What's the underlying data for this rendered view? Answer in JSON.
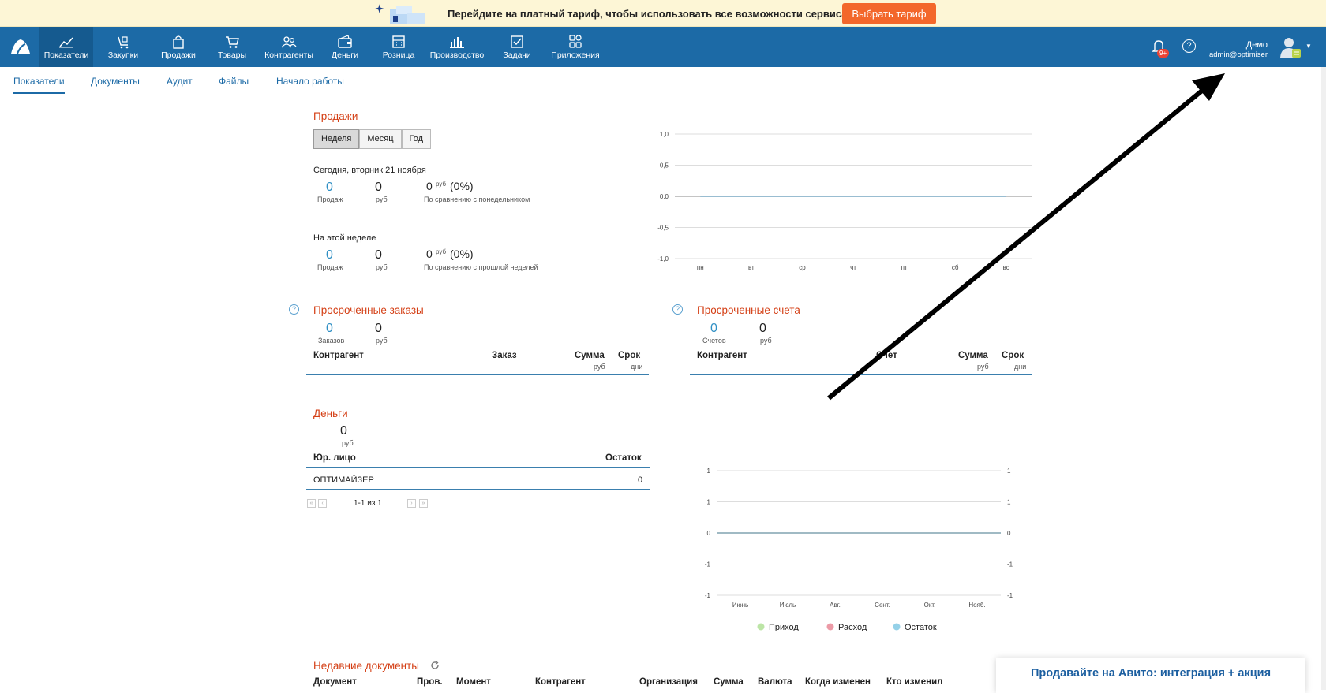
{
  "promo": {
    "text": "Перейдите на платный тариф, чтобы использовать все возможности сервиса",
    "button": "Выбрать тариф"
  },
  "nav": {
    "items": [
      {
        "label": "Показатели",
        "icon": "chart-icon"
      },
      {
        "label": "Закупки",
        "icon": "purchases-icon"
      },
      {
        "label": "Продажи",
        "icon": "bag-icon"
      },
      {
        "label": "Товары",
        "icon": "cart-icon"
      },
      {
        "label": "Контрагенты",
        "icon": "people-icon"
      },
      {
        "label": "Деньги",
        "icon": "wallet-icon"
      },
      {
        "label": "Розница",
        "icon": "register-icon"
      },
      {
        "label": "Производство",
        "icon": "factory-icon"
      },
      {
        "label": "Задачи",
        "icon": "task-icon"
      },
      {
        "label": "Приложения",
        "icon": "apps-icon"
      }
    ],
    "notifications_badge": "9+",
    "help": "?",
    "user_name": "Демо",
    "user_email": "admin@optimiser"
  },
  "subnav": [
    "Показатели",
    "Документы",
    "Аудит",
    "Файлы",
    "Начало работы"
  ],
  "sales": {
    "title": "Продажи",
    "periods": [
      "Неделя",
      "Месяц",
      "Год"
    ],
    "today_label": "Сегодня, вторник 21 ноября",
    "today_count": "0",
    "today_count_label": "Продаж",
    "today_sum": "0",
    "today_sum_label": "руб",
    "today_compare": "0",
    "today_compare_unit": "руб",
    "today_compare_pct": "(0%)",
    "today_compare_label": "По сравнению с понедельником",
    "week_label": "На этой неделе",
    "week_count": "0",
    "week_count_label": "Продаж",
    "week_sum": "0",
    "week_sum_label": "руб",
    "week_compare": "0",
    "week_compare_unit": "руб",
    "week_compare_pct": "(0%)",
    "week_compare_label": "По сравнению с прошлой неделей"
  },
  "overdue_orders": {
    "title": "Просроченные заказы",
    "count": "0",
    "count_label": "Заказов",
    "sum": "0",
    "sum_label": "руб",
    "headers": [
      "Контрагент",
      "Заказ",
      "Сумма",
      "Срок"
    ],
    "sub_sum": "руб",
    "sub_term": "дни"
  },
  "overdue_invoices": {
    "title": "Просроченные счета",
    "count": "0",
    "count_label": "Счетов",
    "sum": "0",
    "sum_label": "руб",
    "headers": [
      "Контрагент",
      "Счет",
      "Сумма",
      "Срок"
    ],
    "sub_sum": "руб",
    "sub_term": "дни"
  },
  "money": {
    "title": "Деньги",
    "total": "0",
    "total_label": "руб",
    "headers": [
      "Юр. лицо",
      "Остаток"
    ],
    "rows": [
      {
        "name": "ОПТИМАЙЗЕР",
        "balance": "0"
      }
    ],
    "pager": "1-1 из 1"
  },
  "recent_docs": {
    "title": "Недавние документы",
    "headers": [
      "Документ",
      "Пров.",
      "Момент",
      "Контрагент",
      "Организация",
      "Сумма",
      "Валюта",
      "Когда изменен",
      "Кто изменил"
    ]
  },
  "avito_banner": "Продавайте на Авито: интеграция + акция",
  "chart_data": [
    {
      "type": "line",
      "categories": [
        "пн",
        "вт",
        "ср",
        "чт",
        "пт",
        "сб",
        "вс"
      ],
      "y_ticks": [
        "1,0",
        "0,5",
        "0,0",
        "-0,5",
        "-1,0"
      ],
      "ylim": [
        -1,
        1
      ],
      "grid": true,
      "series": [
        {
          "values": [
            0,
            0,
            0,
            0,
            0,
            0,
            0
          ],
          "color": "#2f8fc4"
        }
      ]
    },
    {
      "type": "line",
      "categories": [
        "Июнь",
        "Июль",
        "Авг.",
        "Сент.",
        "Окт.",
        "Нояб."
      ],
      "y_ticks_left": [
        "1",
        "1",
        "0",
        "-1",
        "-1"
      ],
      "y_ticks_right": [
        "1",
        "1",
        "0",
        "-1",
        "-1"
      ],
      "ylim": [
        -1,
        1
      ],
      "grid": true,
      "legend_position": "bottom",
      "series": [
        {
          "name": "Приход",
          "values": [
            0,
            0,
            0,
            0,
            0,
            0
          ],
          "color": "#8fd46b"
        },
        {
          "name": "Расход",
          "values": [
            0,
            0,
            0,
            0,
            0,
            0
          ],
          "color": "#e0566a"
        },
        {
          "name": "Остаток",
          "values": [
            0,
            0,
            0,
            0,
            0,
            0
          ],
          "color": "#4fb3d9"
        }
      ]
    }
  ]
}
